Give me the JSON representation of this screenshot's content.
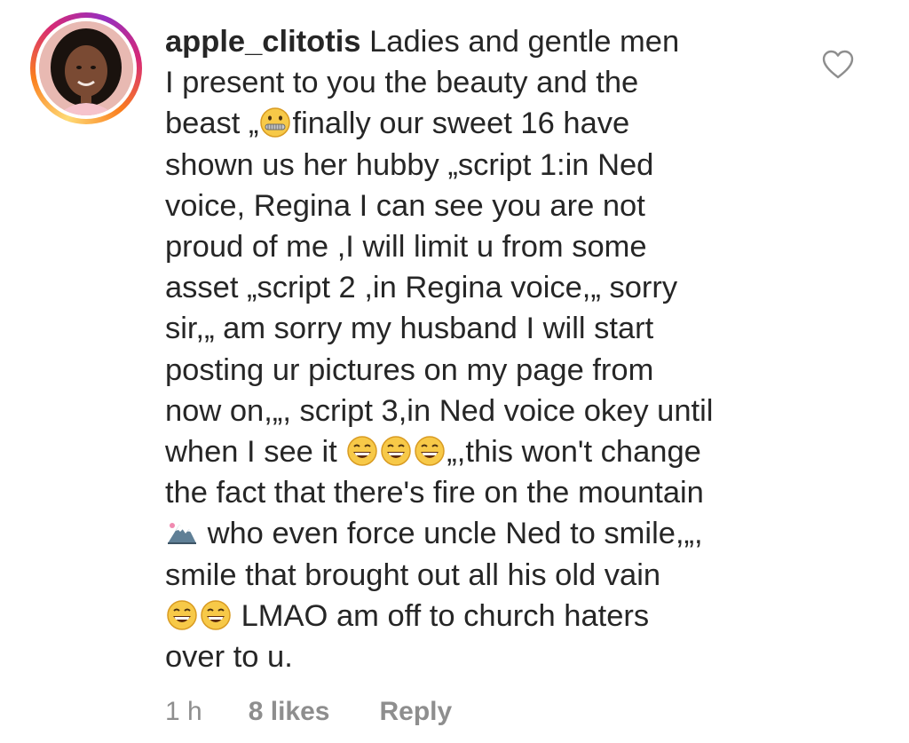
{
  "comment": {
    "username": "apple_clitotis",
    "text_lines": [
      " Ladies and gentle men",
      "I present to you the beauty and the",
      "beast „",
      "finally our sweet 16 have",
      "shown us her hubby „script 1:in Ned",
      "voice, Regina I can see you are not",
      "proud of me ,I will limit u from some",
      "asset „script 2 ,in Regina voice,„ sorry",
      "sir,„ am sorry my husband I will start",
      "posting ur pictures on my page from",
      "now on,„, script 3,in Ned voice okey until",
      "when I see it ",
      "„,this won't change",
      "the fact that there's fire on the mountain",
      " who even force uncle Ned to smile,„,",
      "smile that brought out all his old vain",
      " LMAO am off to church haters",
      "over to u."
    ],
    "emojis": {
      "zipper_mouth": "zipper-mouth-face-icon",
      "grin": "grinning-squinting-face-icon",
      "mountain": "snow-capped-mountain-icon"
    },
    "time": "1 h",
    "likes": "8 likes",
    "reply_label": "Reply"
  },
  "colors": {
    "text": "#262626",
    "meta": "#8e8e8e"
  }
}
